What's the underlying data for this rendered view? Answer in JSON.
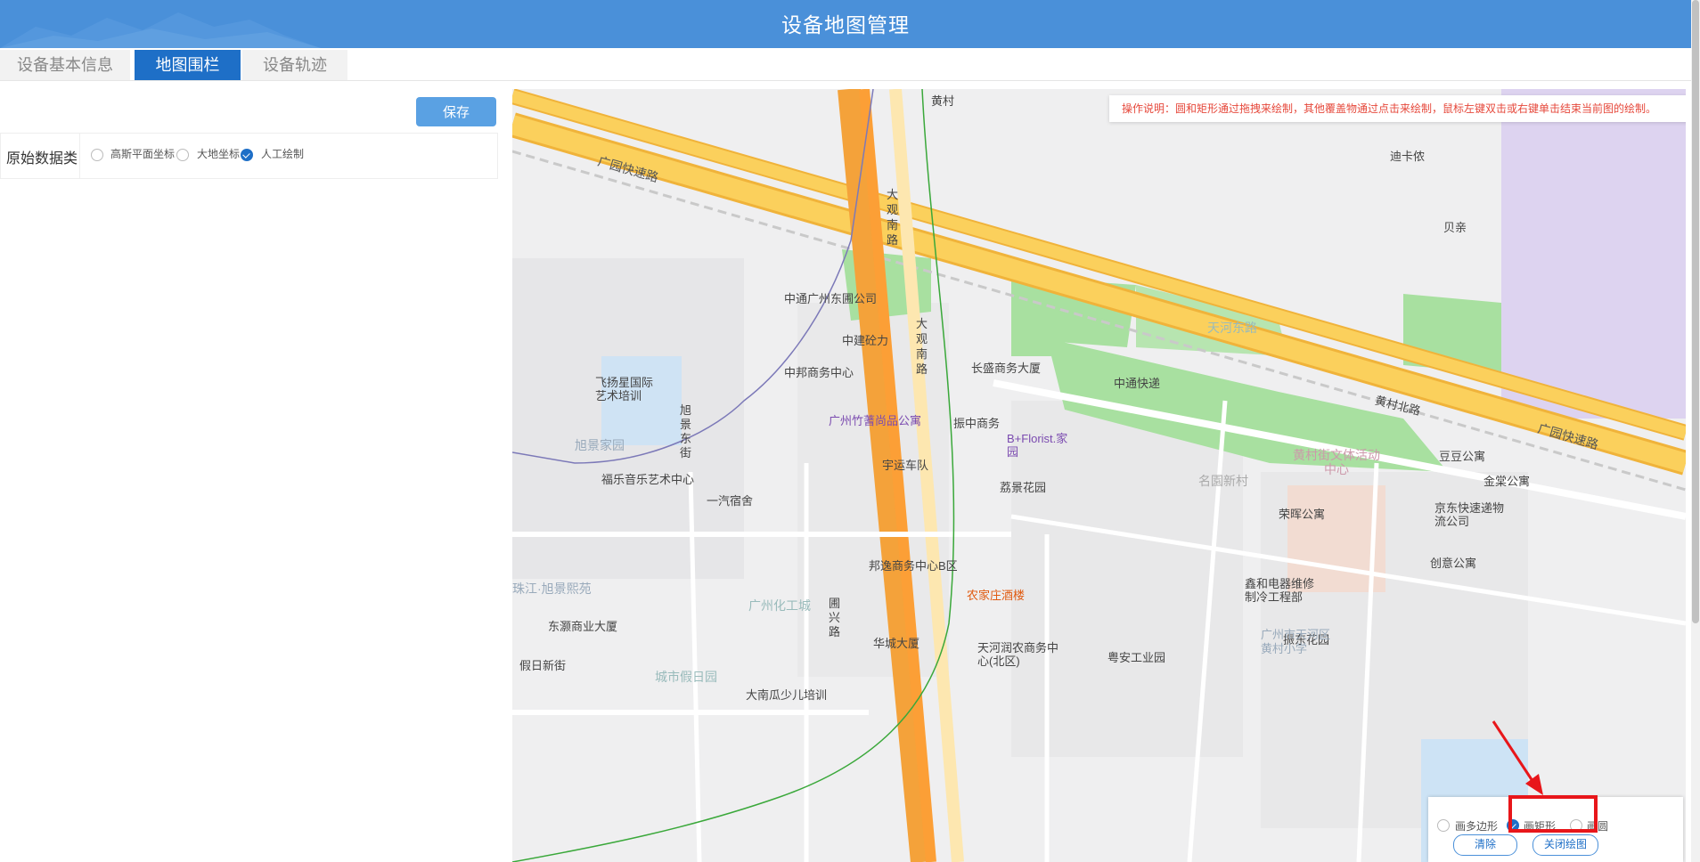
{
  "header": {
    "title": "设备地图管理"
  },
  "tabs": [
    {
      "label": "设备基本信息",
      "active": false
    },
    {
      "label": "地图围栏",
      "active": true
    },
    {
      "label": "设备轨迹",
      "active": false
    }
  ],
  "panel": {
    "save_label": "保存",
    "source_label": "原始数据类",
    "source_options": [
      {
        "label": "高斯平面坐标",
        "checked": false
      },
      {
        "label": "大地坐标",
        "checked": false
      },
      {
        "label": "人工绘制",
        "checked": true
      }
    ]
  },
  "map": {
    "notice": "操作说明：圆和矩形通过拖拽来绘制，其他覆盖物通过点击来绘制，鼠标左键双击或右键单击结束当前图的绘制。",
    "labels": {
      "road1": "广园快速路",
      "road2": "广园快速路",
      "road3": "大观南路",
      "road4": "大观南路",
      "road5": "黄村北路",
      "road6": "天河东路",
      "road7": "旭景东街",
      "road8": "圃兴路",
      "road9": "假日新街",
      "poi1": "黄村",
      "poi2": "迪卡侬",
      "poi3": "贝亲",
      "poi4": "中通广州东圃公司",
      "poi5": "中建砼力",
      "poi6": "中邦商务中心",
      "poi7": "长盛商务大厦",
      "poi8": "中通快递",
      "poi9": "飞扬星国际艺术培训",
      "poi10": "广州竹蓍尚品公寓",
      "poi11": "振中商务",
      "poi12": "B+Florist.家园",
      "poi13": "宇运车队",
      "poi14": "福乐音乐艺术中心",
      "poi15": "一汽宿舍",
      "poi16": "荔景花园",
      "poi17": "名園新村",
      "poi18": "黄村街文体活动中心",
      "poi19": "金棠公寓",
      "poi20": "荣晖公寓",
      "poi21": "京东快速递物流公司",
      "poi22": "邦逸商务中心B区",
      "poi23": "农家庄酒楼",
      "poi24": "东灏商业大厦",
      "poi25": "华城大厦",
      "poi26": "天河润农商务中心(北区)",
      "poi27": "粤安工业园",
      "poi28": "振东花园",
      "poi29": "鑫和电器维修制冷工程部",
      "poi30": "创意公寓",
      "poi31": "大南瓜少儿培训",
      "poi32": "旭景家园",
      "poi33": "珠江·旭景熙苑",
      "poi34": "广州化工城",
      "poi35": "广州市天河区黄村小学",
      "poi36": "豆豆公寓",
      "poi37": "城市假日园"
    }
  },
  "draw_tools": {
    "options": [
      {
        "label": "画多边形",
        "checked": false
      },
      {
        "label": "画矩形",
        "checked": true
      },
      {
        "label": "画圆",
        "checked": false
      }
    ],
    "clear_label": "清除",
    "close_label": "关闭绘图"
  },
  "colors": {
    "header": "#4a90d9",
    "active_tab": "#1e6fc7",
    "highlight": "#e8161a",
    "notice": "#e6483b"
  }
}
